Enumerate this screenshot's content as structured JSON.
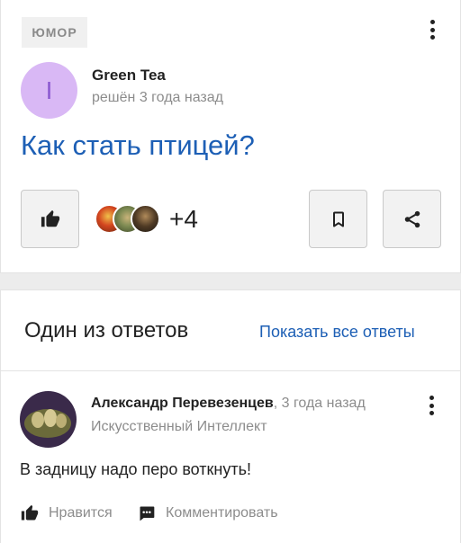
{
  "question": {
    "tag": "ЮМОР",
    "author_initial": "I",
    "author_name": "Green Tea",
    "status": "решён 3 года назад",
    "title": "Как стать птицей?",
    "extra_count": "+4"
  },
  "answers": {
    "section_title": "Один из ответов",
    "show_all": "Показать все ответы",
    "answer": {
      "author_name": "Александр Перевезенцев",
      "time": ", 3 года назад",
      "role": "Искусственный Интеллект",
      "text": "В задницу надо перо воткнуть!",
      "like_label": "Нравится",
      "comment_label": "Комментировать"
    }
  },
  "colors": {
    "link": "#1d5fb5",
    "avatar_bg": "#d9b8f5"
  },
  "icons": [
    "more-vertical-icon",
    "thumb-up-icon",
    "bookmark-icon",
    "share-icon",
    "comment-icon"
  ]
}
